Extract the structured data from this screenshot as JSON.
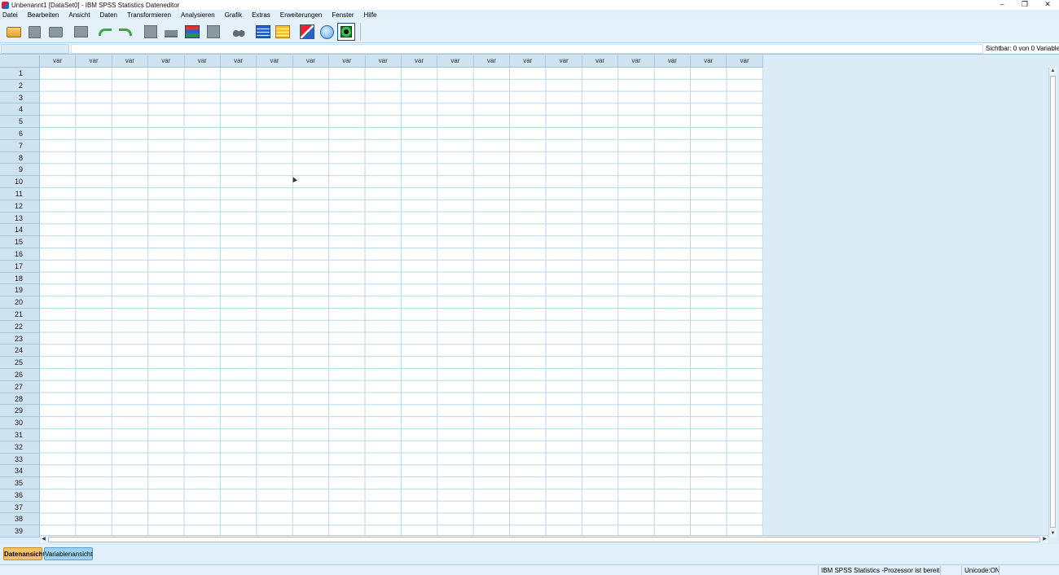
{
  "window": {
    "title": "Unbenannt1 [DataSet0] - IBM SPSS Statistics Dateneditor",
    "minimize": "–",
    "maximize": "❐",
    "close": "✕"
  },
  "menu": [
    "Datei",
    "Bearbeiten",
    "Ansicht",
    "Daten",
    "Transformieren",
    "Analysieren",
    "Grafik",
    "Extras",
    "Erweiterungen",
    "Fenster",
    "Hilfe"
  ],
  "toolbar": {
    "icons": [
      "open-folder-icon",
      "save-icon",
      "print-icon",
      "dialog-recall-icon",
      "undo-icon",
      "redo-icon",
      "goto-case-icon",
      "goto-variable-icon",
      "variables-icon",
      "run-descriptives-icon",
      "find-icon",
      "insert-cases-icon",
      "insert-variable-icon",
      "split-file-icon",
      "weight-cases-icon",
      "select-cases-icon"
    ]
  },
  "status": {
    "visible_variables": "Sichtbar: 0 von 0 Variablen",
    "processor": "IBM SPSS Statistics -Prozessor ist bereit",
    "unicode": "Unicode:ON"
  },
  "grid": {
    "column_label": "var",
    "column_count": 20,
    "rows": [
      "1",
      "2",
      "3",
      "4",
      "5",
      "6",
      "7",
      "8",
      "9",
      "10",
      "11",
      "12",
      "13",
      "14",
      "15",
      "16",
      "17",
      "18",
      "19",
      "20",
      "21",
      "22",
      "23",
      "24",
      "25",
      "26",
      "27",
      "28",
      "29",
      "30",
      "31",
      "32",
      "33",
      "34",
      "35",
      "36",
      "37",
      "38",
      "39"
    ]
  },
  "tabs": {
    "data_view": "Datenansicht",
    "variable_view": "Variablenansicht"
  },
  "colors": {
    "active_tab": "#f4c26a",
    "inactive_tab": "#9fd0ef",
    "grid_line": "#b8d9e6",
    "header_bg": "#cfe2ef"
  }
}
